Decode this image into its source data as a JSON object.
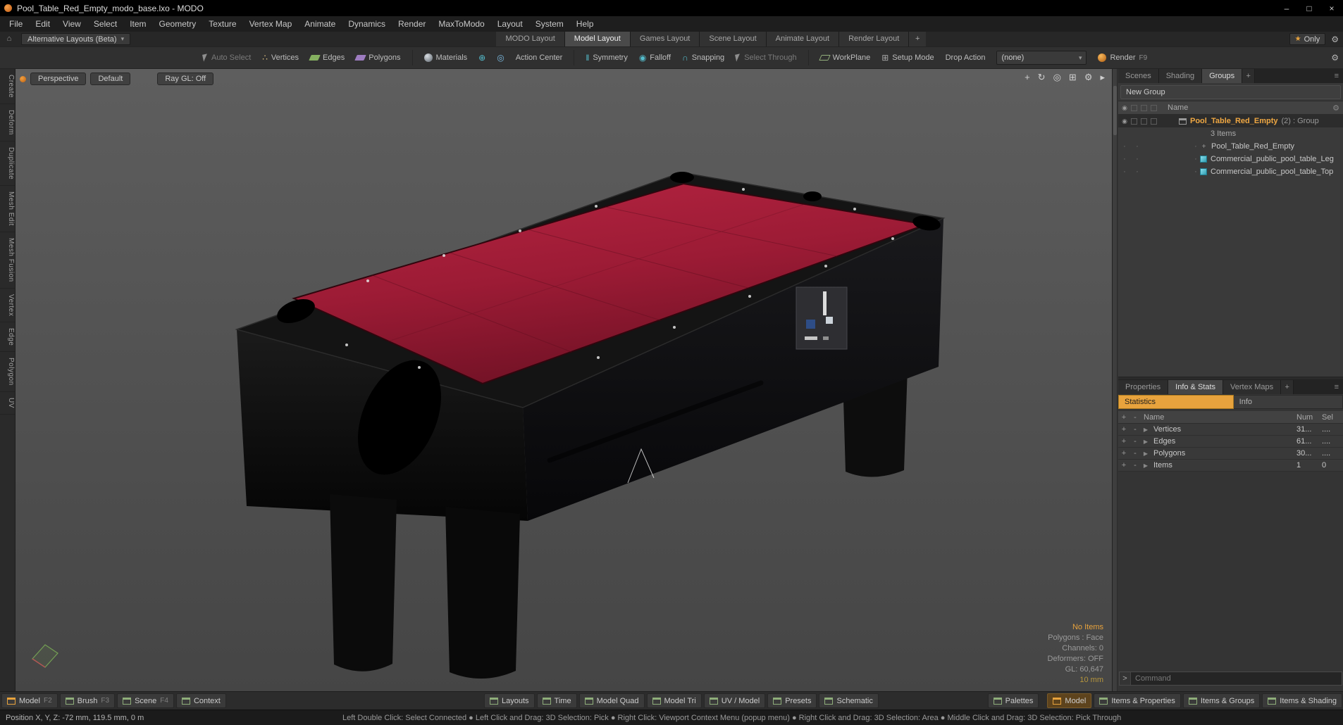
{
  "colors": {
    "accent_orange": "#e8a33d",
    "selection_orange": "#f0a843",
    "felt_red": "#9c1b35",
    "statistics_tab_bg": "#e8a33d",
    "cube_icon_teal": "#8ae0ee"
  },
  "window": {
    "title": "Pool_Table_Red_Empty_modo_base.lxo - MODO"
  },
  "menubar": {
    "items": [
      "File",
      "Edit",
      "View",
      "Select",
      "Item",
      "Geometry",
      "Texture",
      "Vertex Map",
      "Animate",
      "Dynamics",
      "Render",
      "MaxToModo",
      "Layout",
      "System",
      "Help"
    ]
  },
  "layout_bar": {
    "alt_layouts_label": "Alternative Layouts (Beta)",
    "tabs": [
      "MODO Layout",
      "Model Layout",
      "Games Layout",
      "Scene Layout",
      "Animate Layout",
      "Render Layout"
    ],
    "add_tab": "+",
    "only_label": "Only"
  },
  "toolbar": {
    "auto_select": "Auto Select",
    "vertices": "Vertices",
    "edges": "Edges",
    "polygons": "Polygons",
    "materials": "Materials",
    "action_center": "Action Center",
    "symmetry": "Symmetry",
    "falloff": "Falloff",
    "snapping": "Snapping",
    "select_through": "Select Through",
    "workplane": "WorkPlane",
    "setup_mode": "Setup Mode",
    "drop_action_label": "Drop Action",
    "drop_action_value": "(none)",
    "render_label": "Render",
    "render_key": "F9"
  },
  "left_toolbox": {
    "tabs": [
      "Create",
      "Deform",
      "Duplicate",
      "Mesh Edit",
      "Mesh Fusion",
      "Vertex",
      "Edge",
      "Polygon",
      "UV"
    ]
  },
  "viewport": {
    "perspective": "Perspective",
    "default": "Default",
    "ray_gl": "Ray GL: Off",
    "stats": {
      "no_items": "No Items",
      "polygons_mode": "Polygons : Face",
      "channels": "Channels: 0",
      "deformers": "Deformers: OFF",
      "gl": "GL: 60,647",
      "grid": "10 mm"
    }
  },
  "groups_panel": {
    "tabs": [
      "Scenes",
      "Shading",
      "Groups"
    ],
    "add_tab": "+",
    "new_group": "New Group",
    "name_header": "Name",
    "root_name": "Pool_Table_Red_Empty",
    "root_suffix": "(2) : Group",
    "root_items": "3 Items",
    "children": [
      "Pool_Table_Red_Empty",
      "Commercial_public_pool_table_Leg",
      "Commercial_public_pool_table_Top"
    ]
  },
  "info_panel": {
    "tabs": [
      "Properties",
      "Info & Stats",
      "Vertex Maps"
    ],
    "add_tab": "+",
    "subtab_statistics": "Statistics",
    "subtab_info": "Info",
    "header": {
      "plus": "+",
      "minus": "-",
      "name": "Name",
      "num": "Num",
      "sel": "Sel"
    },
    "rows": [
      {
        "name": "Vertices",
        "num": "31...",
        "sel": "...."
      },
      {
        "name": "Edges",
        "num": "61...",
        "sel": "...."
      },
      {
        "name": "Polygons",
        "num": "30...",
        "sel": "...."
      },
      {
        "name": "Items",
        "num": "1",
        "sel": "0"
      }
    ],
    "command_placeholder": "Command"
  },
  "bottom_bar": {
    "left": [
      {
        "label": "Model",
        "key": "F2"
      },
      {
        "label": "Brush",
        "key": "F3"
      },
      {
        "label": "Scene",
        "key": "F4"
      },
      {
        "label": "Context",
        "key": ""
      }
    ],
    "center": [
      "Layouts",
      "Time",
      "Model Quad",
      "Model Tri",
      "UV / Model",
      "Presets",
      "Schematic"
    ],
    "right_palettes": "Palettes",
    "right_model": "Model",
    "right_tabs": [
      "Items & Properties",
      "Items & Groups",
      "Items & Shading"
    ]
  },
  "status_bar": {
    "position": "Position X, Y, Z:    -72 mm, 119.5 mm, 0 m",
    "hints": "Left Double Click: Select Connected  ●  Left Click and Drag: 3D Selection: Pick  ●  Right Click: Viewport Context Menu (popup menu)  ●  Right Click and Drag: 3D Selection: Area  ●  Middle Click and Drag: 3D Selection: Pick Through"
  },
  "icons": {
    "home": "⌂",
    "caret": "▾",
    "star": "★",
    "gear": "⚙",
    "menu": "≡",
    "pan": "+",
    "rotate": "↻",
    "zoom": "◎",
    "maximize": "⊞",
    "more": "▸",
    "eye": "◉",
    "expand": "▶",
    "prompt": ">",
    "locator": "+",
    "connector": "·",
    "min": "–",
    "max": "□",
    "close": "×",
    "vertices": "∴",
    "target": "⊕",
    "orbit": "◎",
    "symmetry": "‖",
    "falloff": "◉",
    "snap": "∩",
    "setup": "⊞"
  }
}
